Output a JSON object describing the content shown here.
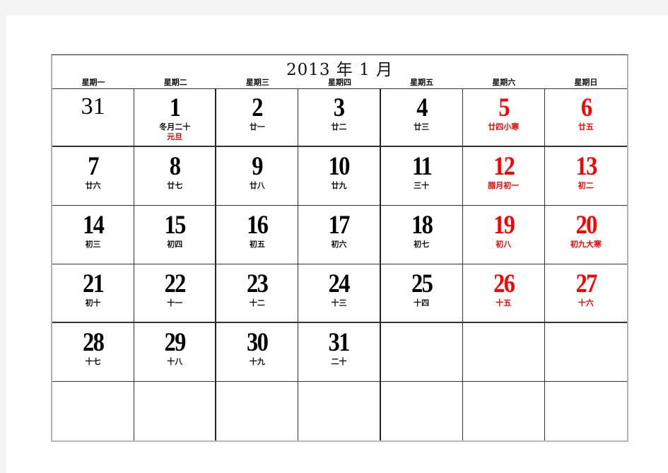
{
  "calendar": {
    "title": "2013 年 1 月",
    "weekdays": [
      "星期一",
      "星期二",
      "星期三",
      "星期四",
      "星期五",
      "星期六",
      "星期日"
    ],
    "colors": {
      "weekend": "#ff0000",
      "weekday": "#000000",
      "holiday": "#e00000"
    },
    "weeks": [
      [
        {
          "day": "31",
          "lunar": "",
          "type": "prev-month"
        },
        {
          "day": "1",
          "lunar": "冬月二十",
          "holiday": "元旦"
        },
        {
          "day": "2",
          "lunar": "廿一"
        },
        {
          "day": "3",
          "lunar": "廿二"
        },
        {
          "day": "4",
          "lunar": "廿三"
        },
        {
          "day": "5",
          "lunar": "廿四小寒",
          "weekend": true
        },
        {
          "day": "6",
          "lunar": "廿五",
          "weekend": true
        }
      ],
      [
        {
          "day": "7",
          "lunar": "廿六"
        },
        {
          "day": "8",
          "lunar": "廿七"
        },
        {
          "day": "9",
          "lunar": "廿八"
        },
        {
          "day": "10",
          "lunar": "廿九"
        },
        {
          "day": "11",
          "lunar": "三十"
        },
        {
          "day": "12",
          "lunar": "腊月初一",
          "weekend": true
        },
        {
          "day": "13",
          "lunar": "初二",
          "weekend": true
        }
      ],
      [
        {
          "day": "14",
          "lunar": "初三"
        },
        {
          "day": "15",
          "lunar": "初四"
        },
        {
          "day": "16",
          "lunar": "初五"
        },
        {
          "day": "17",
          "lunar": "初六"
        },
        {
          "day": "18",
          "lunar": "初七"
        },
        {
          "day": "19",
          "lunar": "初八",
          "weekend": true
        },
        {
          "day": "20",
          "lunar": "初九大寒",
          "weekend": true
        }
      ],
      [
        {
          "day": "21",
          "lunar": "初十"
        },
        {
          "day": "22",
          "lunar": "十一"
        },
        {
          "day": "23",
          "lunar": "十二"
        },
        {
          "day": "24",
          "lunar": "十三"
        },
        {
          "day": "25",
          "lunar": "十四"
        },
        {
          "day": "26",
          "lunar": "十五",
          "weekend": true
        },
        {
          "day": "27",
          "lunar": "十六",
          "weekend": true
        }
      ],
      [
        {
          "day": "28",
          "lunar": "十七"
        },
        {
          "day": "29",
          "lunar": "十八"
        },
        {
          "day": "30",
          "lunar": "十九"
        },
        {
          "day": "31",
          "lunar": "二十"
        },
        {
          "day": "",
          "lunar": ""
        },
        {
          "day": "",
          "lunar": ""
        },
        {
          "day": "",
          "lunar": ""
        }
      ],
      [
        {
          "day": "",
          "lunar": ""
        },
        {
          "day": "",
          "lunar": ""
        },
        {
          "day": "",
          "lunar": ""
        },
        {
          "day": "",
          "lunar": ""
        },
        {
          "day": "",
          "lunar": ""
        },
        {
          "day": "",
          "lunar": ""
        },
        {
          "day": "",
          "lunar": ""
        }
      ]
    ]
  }
}
